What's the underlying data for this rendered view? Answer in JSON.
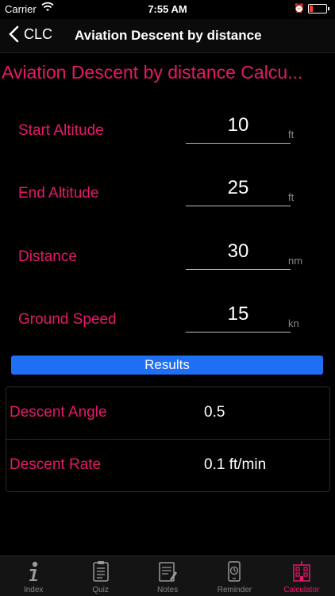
{
  "status": {
    "carrier": "Carrier",
    "time": "7:55 AM"
  },
  "nav": {
    "back_label": "CLC",
    "title": "Aviation Descent by distance"
  },
  "heading": "Aviation Descent by distance Calcu...",
  "fields": [
    {
      "label": "Start Altitude",
      "value": "10",
      "unit": "ft"
    },
    {
      "label": "End Altitude",
      "value": "25",
      "unit": "ft"
    },
    {
      "label": "Distance",
      "value": "30",
      "unit": "nm"
    },
    {
      "label": "Ground Speed",
      "value": "15",
      "unit": "kn"
    }
  ],
  "results_label": "Results",
  "results": [
    {
      "label": "Descent Angle",
      "value": "0.5"
    },
    {
      "label": "Descent Rate",
      "value": "0.1 ft/min"
    }
  ],
  "tabs": [
    {
      "label": "Index",
      "icon": "info-icon"
    },
    {
      "label": "Quiz",
      "icon": "clipboard-icon"
    },
    {
      "label": "Notes",
      "icon": "notes-icon"
    },
    {
      "label": "Reminder",
      "icon": "phone-clock-icon"
    },
    {
      "label": "Calculator",
      "icon": "building-calculator-icon"
    }
  ],
  "colors": {
    "accent": "#e8196a",
    "button": "#1f6ff5",
    "background": "#000000"
  }
}
